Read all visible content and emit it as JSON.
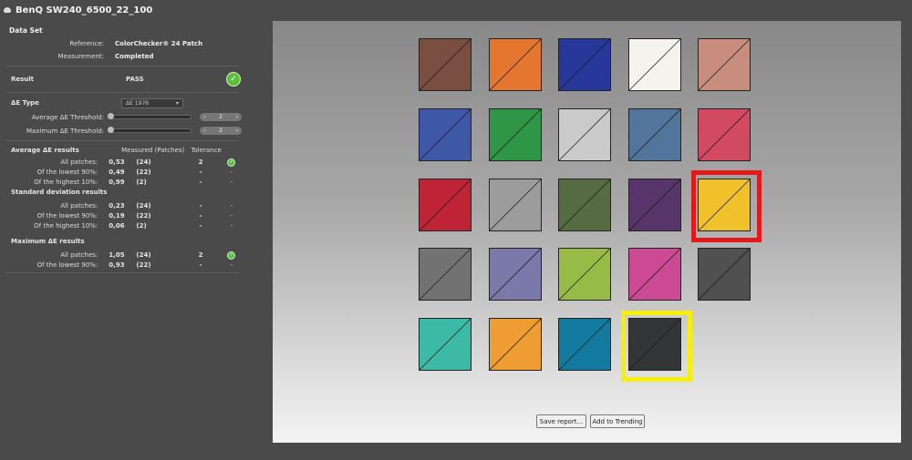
{
  "title": "BenQ SW240_6500_22_100",
  "dataset": {
    "heading": "Data Set",
    "reference_label": "Reference:",
    "reference_value": "ColorChecker® 24 Patch",
    "measurement_label": "Measurement:",
    "measurement_value": "Completed"
  },
  "result": {
    "label": "Result",
    "value": "PASS"
  },
  "delta_e": {
    "label": "ΔE Type",
    "type_value": "ΔE 1976",
    "avg_threshold_label": "Average  ΔE Threshold:",
    "avg_threshold_value": "2",
    "max_threshold_label": "Maximum ΔE Threshold:",
    "max_threshold_value": "2"
  },
  "stats": {
    "avg_heading": "Average ΔE results",
    "col_measured": "Measured (Patches)",
    "col_tolerance": "Tolerance",
    "avg_rows": [
      {
        "label": "All patches:",
        "measured": "0,53",
        "patches": "(24)",
        "tolerance": "2",
        "status": "ok"
      },
      {
        "label": "Of the lowest 90%:",
        "measured": "0,49",
        "patches": "(22)",
        "tolerance": "-",
        "status": "-"
      },
      {
        "label": "Of the highest 10%:",
        "measured": "0,99",
        "patches": "(2)",
        "tolerance": "-",
        "status": "-"
      }
    ],
    "std_heading": "Standard deviation results",
    "std_rows": [
      {
        "label": "All patches:",
        "measured": "0,23",
        "patches": "(24)",
        "tolerance": "-",
        "status": "-"
      },
      {
        "label": "Of the lowest 90%:",
        "measured": "0,19",
        "patches": "(22)",
        "tolerance": "-",
        "status": "-"
      },
      {
        "label": "Of the highest 10%:",
        "measured": "0,06",
        "patches": "(2)",
        "tolerance": "-",
        "status": "-"
      }
    ],
    "max_heading": "Maximum ΔE results",
    "max_rows": [
      {
        "label": "All patches:",
        "measured": "1,05",
        "patches": "(24)",
        "tolerance": "2",
        "status": "ok"
      },
      {
        "label": "Of the lowest 90%:",
        "measured": "0,93",
        "patches": "(22)",
        "tolerance": "-",
        "status": "-"
      }
    ]
  },
  "patches": [
    [
      "#7a4f42",
      "#e5762f",
      "#27389a",
      "#f5f3ee",
      "#c98d7e"
    ],
    [
      "#3e57a6",
      "#2f9648",
      "#cacaca",
      "#52759c",
      "#d24a61"
    ],
    [
      "#be2436",
      "#9c9c9c",
      "#566b42",
      "#57346a",
      "#f1c12b"
    ],
    [
      "#727272",
      "#7b79aa",
      "#98bb48",
      "#cc4a94",
      "#505050"
    ],
    [
      "#3dbaa6",
      "#ee9d33",
      "#127a9f",
      "#343536"
    ]
  ],
  "highlight_colors": {
    "red": "#e3181a",
    "yellow": "#f6ef0b"
  },
  "buttons": {
    "save_report": "Save report...",
    "add_trending": "Add to Trending"
  }
}
